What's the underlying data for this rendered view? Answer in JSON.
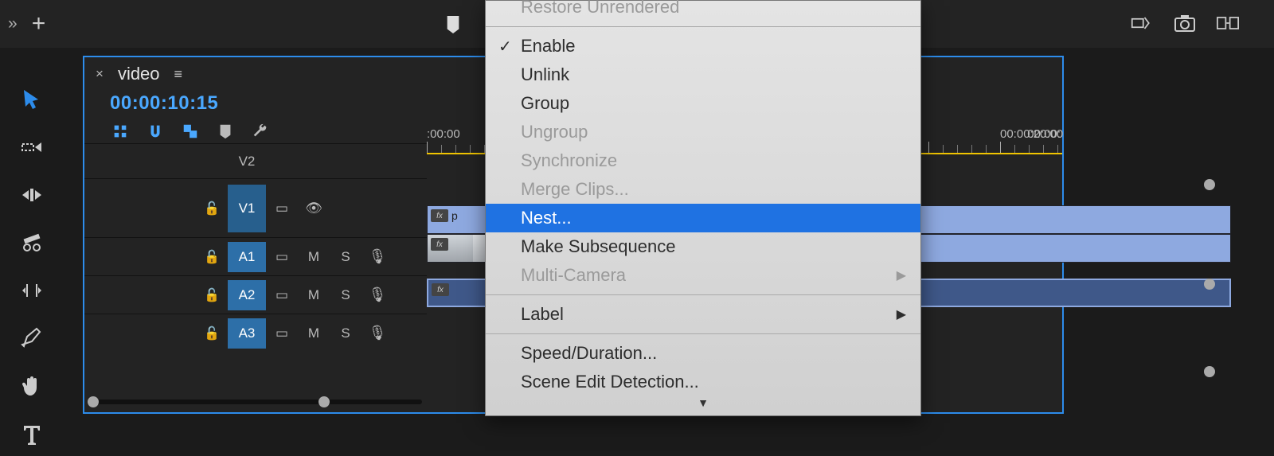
{
  "top_bar": {
    "chevrons": "»",
    "plus": "+"
  },
  "tools": [
    "selection",
    "track-select",
    "ripple",
    "razor",
    "slip",
    "pen",
    "hand",
    "type"
  ],
  "sequence": {
    "close": "×",
    "name": "video",
    "menu": "≡"
  },
  "timecode": "00:00:10:15",
  "ruler": {
    "t1": ":00:00",
    "t2": "00:00:20:00",
    "t3": "00:00:"
  },
  "tracks": {
    "v2": "V2",
    "v1": "V1",
    "a1": "A1",
    "a2": "A2",
    "a3": "A3",
    "m": "M",
    "s": "S",
    "fx": "fx",
    "p": "p"
  },
  "menu": {
    "restore": "Restore Unrendered",
    "enable": "Enable",
    "unlink": "Unlink",
    "group": "Group",
    "ungroup": "Ungroup",
    "synchronize": "Synchronize",
    "merge": "Merge Clips...",
    "nest": "Nest...",
    "subseq": "Make Subsequence",
    "multicam": "Multi-Camera",
    "label": "Label",
    "speed": "Speed/Duration...",
    "scene": "Scene Edit Detection..."
  }
}
